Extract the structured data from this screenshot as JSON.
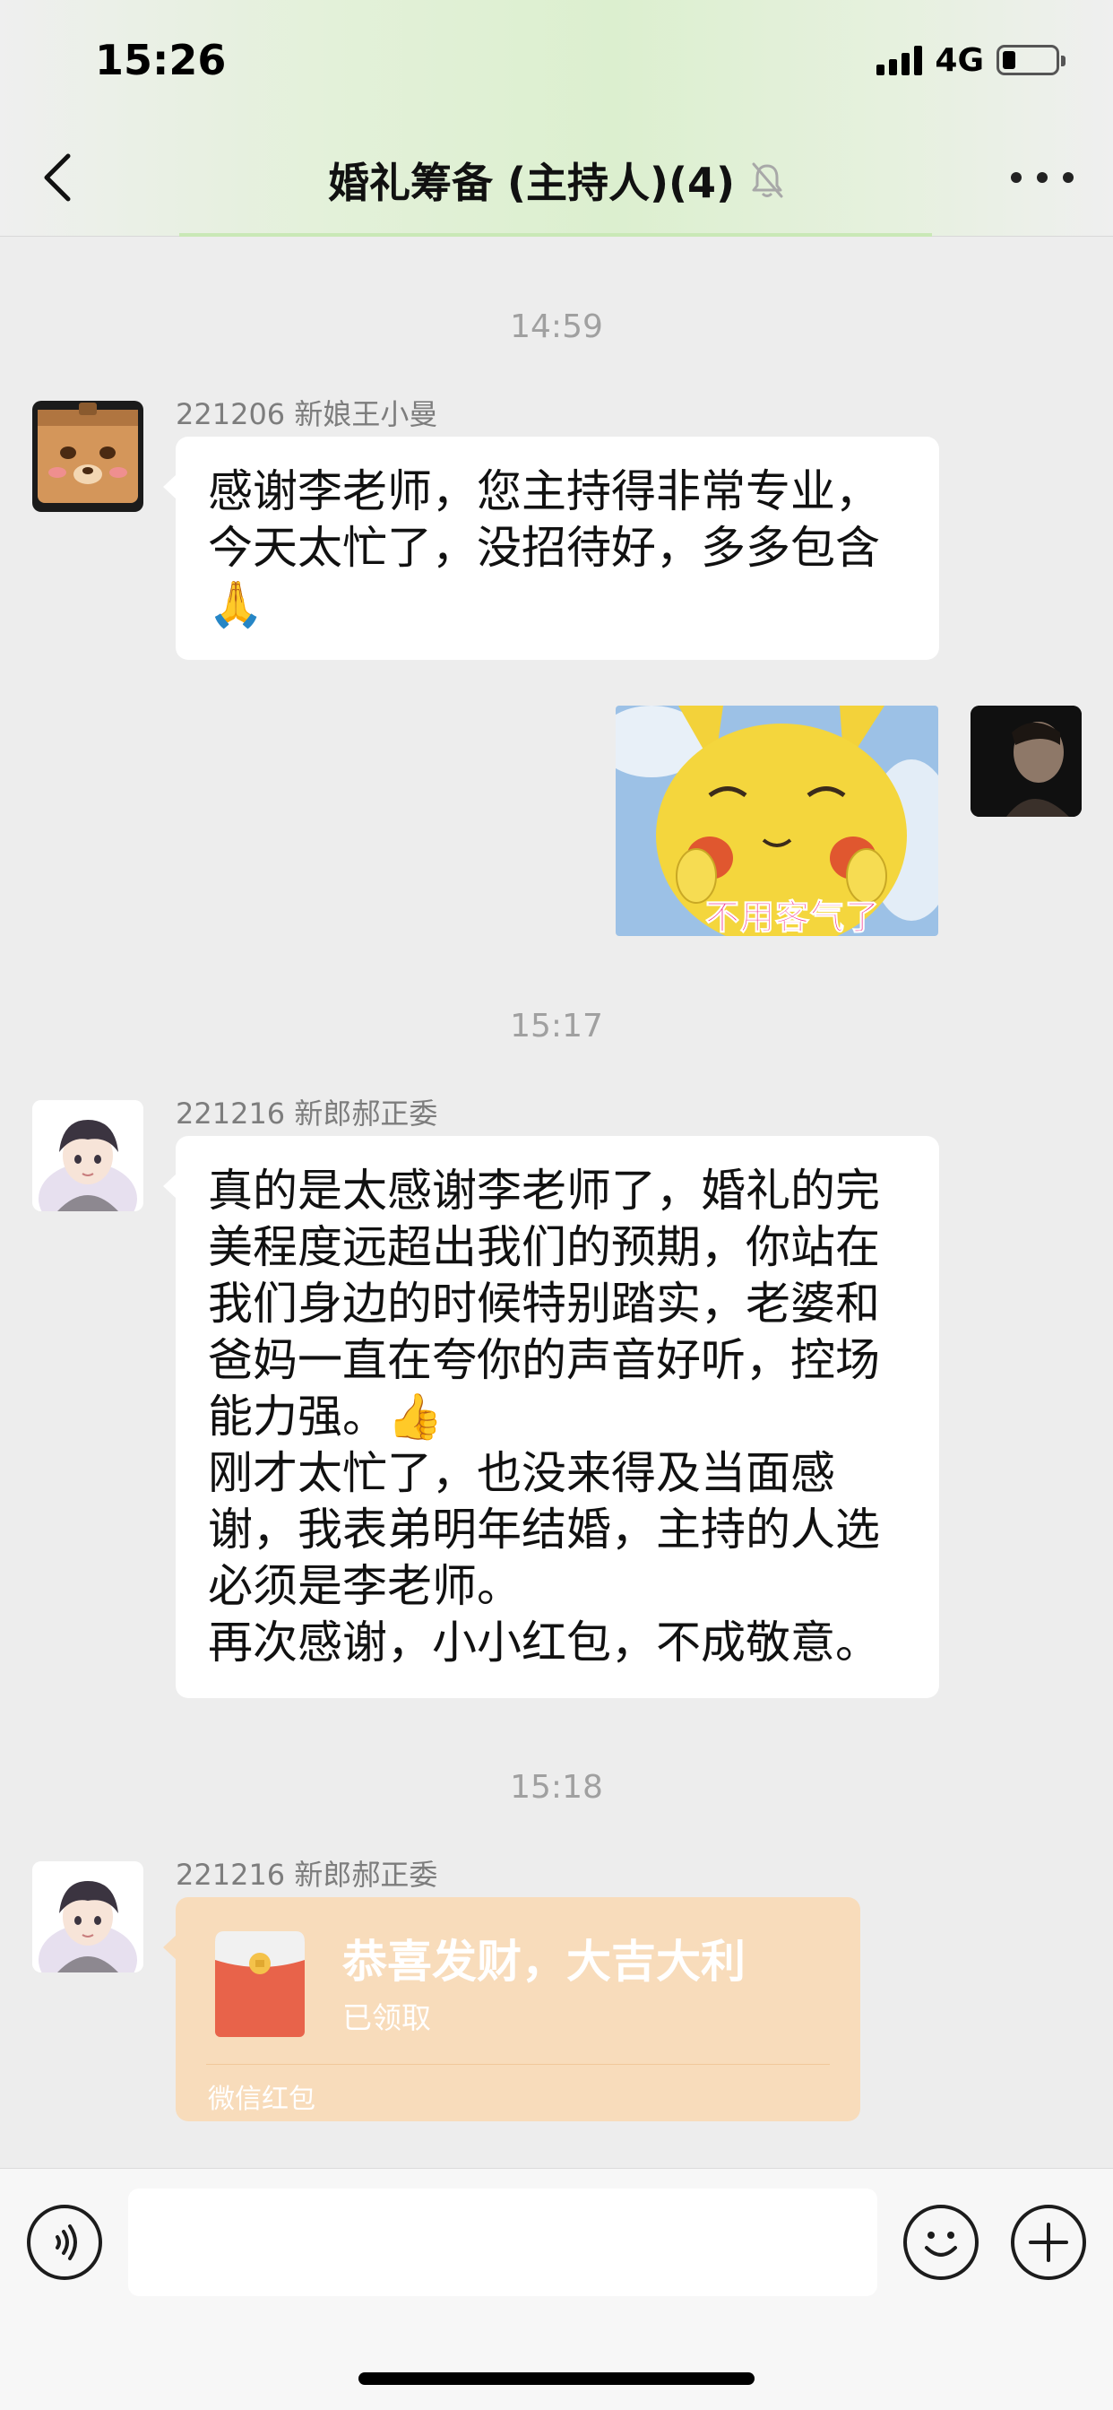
{
  "status_bar": {
    "time": "15:26",
    "network": "4G",
    "battery_level": 0.2
  },
  "header": {
    "title": "婚礼筹备 (主持人)(4)",
    "back_icon": "chevron-left-icon",
    "mute_icon": "bell-slash-icon",
    "more_icon": "more-dots-icon"
  },
  "messages": {
    "time_1": "14:59",
    "msg_1": {
      "sender": "221206 新娘王小曼",
      "text": "感谢李老师，您主持得非常专业，\n今天太忙了，没招待好，多多包含\n🙏"
    },
    "msg_2": {
      "sticker_caption": "不用客气了"
    },
    "time_2": "15:17",
    "msg_3": {
      "sender": "221216 新郎郝正委",
      "text": "真的是太感谢李老师了，婚礼的完\n美程度远超出我们的预期，你站在\n我们身边的时候特别踏实，老婆和\n爸妈一直在夸你的声音好听，控场\n能力强。👍\n刚才太忙了，也没来得及当面感\n谢，我表弟明年结婚，主持的人选\n必须是李老师。\n再次感谢，小小红包，不成敬意。"
    },
    "time_3": "15:18",
    "msg_4": {
      "sender": "221216 新郎郝正委",
      "red_packet": {
        "title": "恭喜发财，大吉大利",
        "status": "已领取",
        "footer": "微信红包"
      }
    }
  },
  "input_bar": {
    "voice_icon": "voice-icon",
    "emoji_icon": "emoji-icon",
    "plus_icon": "plus-icon",
    "value": ""
  },
  "colors": {
    "background": "#ededed",
    "bubble": "#ffffff",
    "red_packet": "#f8dcbb",
    "sticker_caption": "#f2338c"
  }
}
